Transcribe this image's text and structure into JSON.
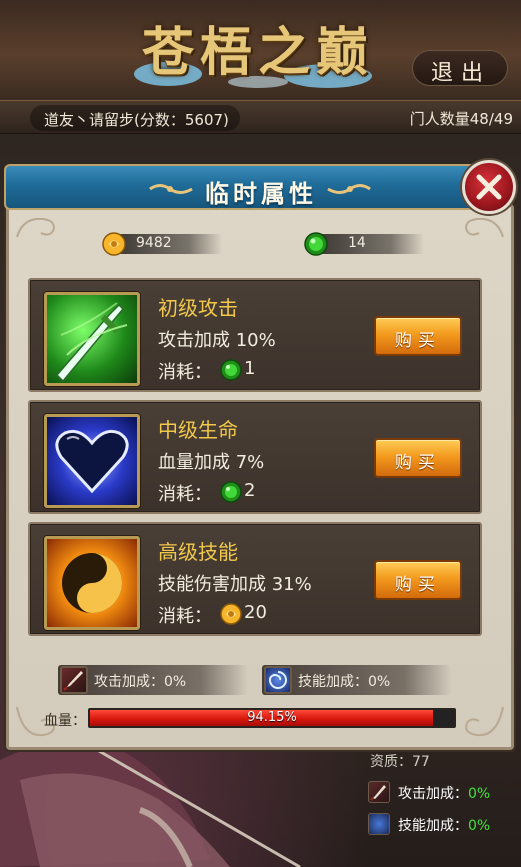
{
  "header": {
    "title": "苍梧之巅",
    "exit_label": "退出"
  },
  "infobar": {
    "left_text": "道友丶请留步(分数：5607)",
    "right_text": "门人数量48/49"
  },
  "dialog": {
    "title": "临时属性",
    "close_icon": "close-x-icon"
  },
  "currency": {
    "gold_value": "9482",
    "gem_value": "14"
  },
  "items": [
    {
      "name": "初级攻击",
      "effect": "攻击加成  10%",
      "cost_label": "消耗：",
      "cost_value": "1",
      "cost_icon": "green-gem-icon",
      "buy_label": "购买",
      "icon": "sword-icon"
    },
    {
      "name": "中级生命",
      "effect": "血量加成  7%",
      "cost_label": "消耗：",
      "cost_value": "2",
      "cost_icon": "green-gem-icon",
      "buy_label": "购买",
      "icon": "heart-icon"
    },
    {
      "name": "高级技能",
      "effect": "技能伤害加成  31%",
      "cost_label": "消耗：",
      "cost_value": "20",
      "cost_icon": "gold-coin-icon",
      "buy_label": "购买",
      "icon": "yin-yang-icon"
    }
  ],
  "bonuses": {
    "attack_label": "攻击加成：",
    "attack_value": "0%",
    "skill_label": "技能加成：",
    "skill_value": "0%"
  },
  "hp": {
    "label": "血量：",
    "percent_text": "94.15%",
    "fraction": 0.9415
  },
  "background_stats": {
    "quality_text": "资质：77",
    "attack_label": "攻击加成：",
    "attack_value": "0%",
    "skill_label": "技能加成：",
    "skill_value": "0%"
  },
  "colors": {
    "accent_gold": "#f2c94a",
    "header_blue": "#1f6b98",
    "buy_orange": "#f39a1e",
    "hp_red": "#d8180e",
    "bonus_green": "#44e13a"
  }
}
